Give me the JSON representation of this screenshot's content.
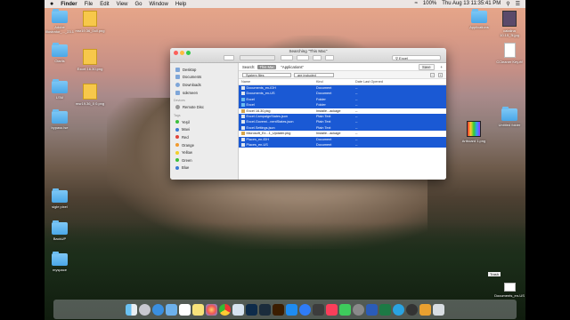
{
  "menubar": {
    "apple": "",
    "app": "Finder",
    "items": [
      "File",
      "Edit",
      "View",
      "Go",
      "Window",
      "Help"
    ],
    "battery": "100%",
    "clock": "Thu Aug 13  11:35:41 PM"
  },
  "desktop_left": [
    {
      "label": "Adobe Illustrator_..._23.1"
    },
    {
      "label": "msr19.36_0ull.png"
    },
    {
      "label": "Olarlis"
    },
    {
      "label": "Excel 16.30.png"
    },
    {
      "label": "LSM"
    },
    {
      "label": "msr19.36_0 0.png"
    },
    {
      "label": "bypass ise"
    },
    {
      "label": "sigle pixel"
    },
    {
      "label": "BackUP"
    },
    {
      "label": "myspace"
    }
  ],
  "desktop_right": [
    {
      "label": "catalina 10.15_3l.jpg"
    },
    {
      "label": "Applications"
    },
    {
      "label": "CCleaner Key.rtf"
    },
    {
      "label": "Untitled folder"
    },
    {
      "label": "Artboard 1.png"
    },
    {
      "label": "Documents_en-US"
    },
    {
      "label": "Trash"
    }
  ],
  "finder": {
    "title": "Searching \"This Mac\"",
    "search_value": "Excel",
    "search_label": "Search:",
    "scope_this_mac": "This Mac",
    "scope_applications": "\"Applications\"",
    "save_button": "Save",
    "criteria_field": "System files",
    "criteria_op": "are included",
    "sidebar": {
      "favorites": [
        "Desktop",
        "Documents",
        "Downloads",
        "sokmeen"
      ],
      "devices_header": "Devices",
      "devices": [
        "Remote Disc"
      ],
      "tags_header": "Tags",
      "tags": [
        {
          "name": "Yeşil",
          "color": "#3cbf3c"
        },
        {
          "name": "Mavi",
          "color": "#3a7bd5"
        },
        {
          "name": "Red",
          "color": "#e0453a"
        },
        {
          "name": "Orange",
          "color": "#f19a2e"
        },
        {
          "name": "Yellow",
          "color": "#f2cf2c"
        },
        {
          "name": "Green",
          "color": "#3cbf3c"
        },
        {
          "name": "Blue",
          "color": "#3a7bd5"
        }
      ]
    },
    "columns": [
      "Name",
      "Kind",
      "Date Last Opened"
    ],
    "rows": [
      {
        "name": "Documents_en-IDH",
        "kind": "Document",
        "date": "--",
        "selected": true
      },
      {
        "name": "Documents_en-US",
        "kind": "Document",
        "date": "--",
        "selected": true
      },
      {
        "name": "Excel",
        "kind": "Folder",
        "date": "--",
        "selected": true
      },
      {
        "name": "Excel",
        "kind": "Folder",
        "date": "--",
        "selected": true
      },
      {
        "name": "Excel 16.30.pkg",
        "kind": "Installe...ackage",
        "date": "--",
        "selected": false
      },
      {
        "name": "Excel.CampaignStates.json",
        "kind": "Plain Text",
        "date": "--",
        "selected": true
      },
      {
        "name": "Excel.Governi...nentStates.json",
        "kind": "Plain Text",
        "date": "--",
        "selected": true
      },
      {
        "name": "Excel.Settings.json",
        "kind": "Plain Text",
        "date": "--",
        "selected": true
      },
      {
        "name": "Microsoft_Ex...1_Updater.pkg",
        "kind": "Installe...ackage",
        "date": "--",
        "selected": false
      },
      {
        "name": "Places_en-IDH",
        "kind": "Document",
        "date": "--",
        "selected": true
      },
      {
        "name": "Places_en-US",
        "kind": "Document",
        "date": "--",
        "selected": true
      }
    ]
  },
  "dock_apps": [
    "finder-icon",
    "launchpad-icon",
    "safari-icon",
    "mail-icon",
    "calendar-icon",
    "notes-icon",
    "photos-icon",
    "chrome-icon",
    "preview-icon",
    "photoshop-icon",
    "lightroom-icon",
    "illustrator-icon",
    "app-store-icon",
    "messenger-icon",
    "facetime-icon",
    "music-icon",
    "messages-icon",
    "system-prefs-icon",
    "word-icon",
    "excel-icon",
    "telegram-icon",
    "vpn-icon",
    "utility-icon",
    "trash-icon"
  ]
}
